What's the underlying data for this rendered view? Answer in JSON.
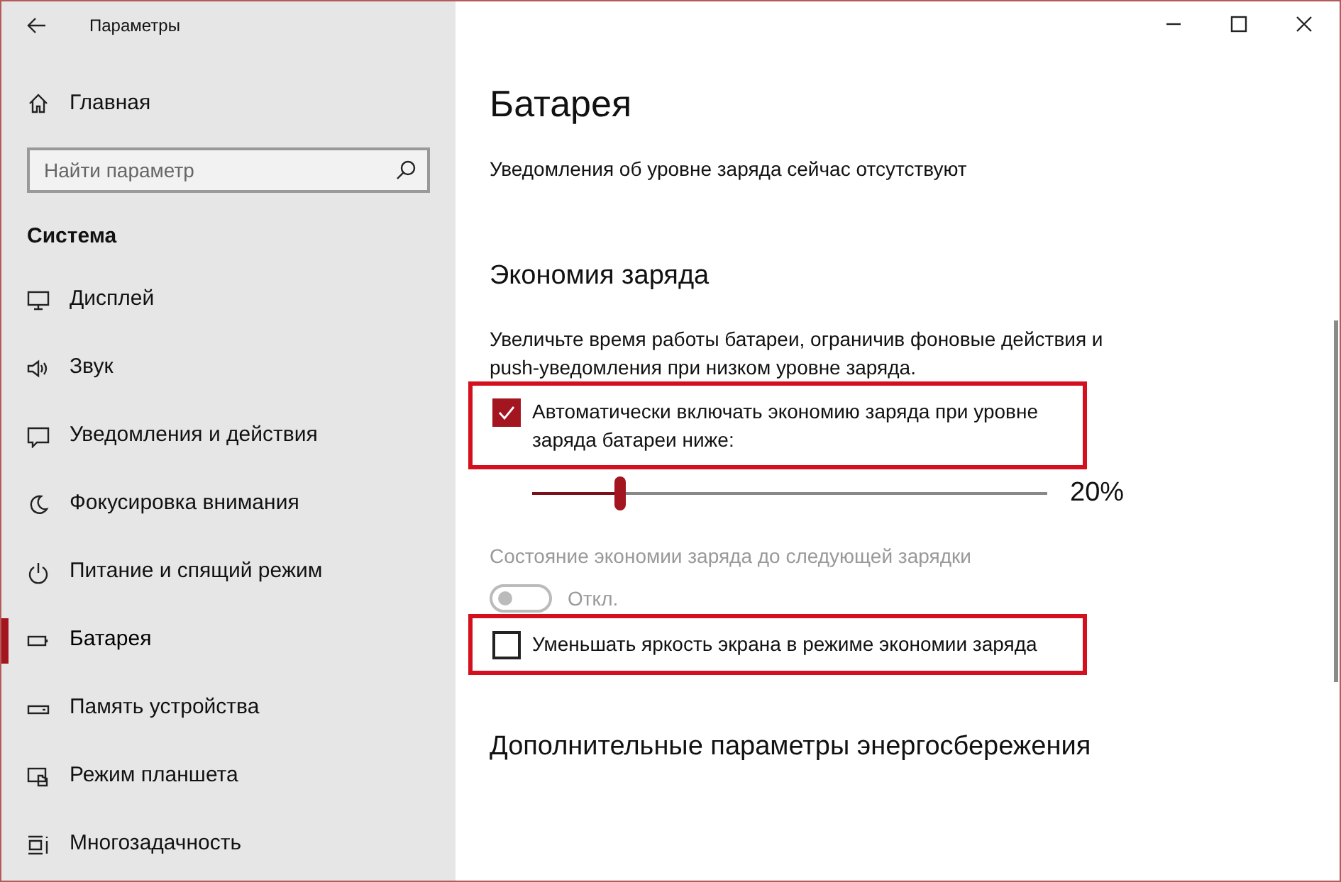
{
  "window": {
    "title": "Параметры"
  },
  "sidebar": {
    "home": "Главная",
    "search": {
      "placeholder": "Найти параметр"
    },
    "section": "Система",
    "items": [
      {
        "label": "Дисплей",
        "selected": false
      },
      {
        "label": "Звук",
        "selected": false
      },
      {
        "label": "Уведомления и действия",
        "selected": false
      },
      {
        "label": "Фокусировка внимания",
        "selected": false
      },
      {
        "label": "Питание и спящий режим",
        "selected": false
      },
      {
        "label": "Батарея",
        "selected": true
      },
      {
        "label": "Память устройства",
        "selected": false
      },
      {
        "label": "Режим планшета",
        "selected": false
      },
      {
        "label": "Многозадачность",
        "selected": false
      }
    ]
  },
  "page": {
    "title": "Батарея",
    "notice": "Уведомления об уровне заряда сейчас отсутствуют",
    "saver": {
      "heading": "Экономия заряда",
      "description": "Увеличьте время работы батареи, ограничив фоновые действия и push-уведомления при низком уровне заряда.",
      "auto": {
        "label": "Автоматически включать экономию заряда при уровне заряда батареи ниже:",
        "checked": true,
        "highlighted": true
      },
      "threshold": {
        "level": 0.17,
        "reading": "20%"
      },
      "status": {
        "label": "Состояние экономии заряда до следующей зарядки",
        "on": false,
        "disabled": true,
        "state_text": "Откл."
      },
      "dim": {
        "label": "Уменьшать яркость экрана в режиме экономии заряда",
        "checked": false,
        "highlighted": true
      }
    },
    "more_heading": "Дополнительные параметры энергосбережения"
  }
}
